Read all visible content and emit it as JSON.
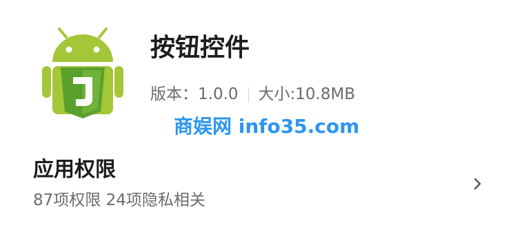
{
  "app": {
    "name": "按钮控件",
    "version_label": "版本：",
    "version_value": "1.0.0",
    "size_label": "大小:",
    "size_value": "10.8MB",
    "icon": "android-html5-icon"
  },
  "watermark": "商娱网 info35.com",
  "permissions": {
    "title": "应用权限",
    "summary": "87项权限 24项隐私相关"
  },
  "colors": {
    "android_green": "#a4c639",
    "shield_green": "#5aa02c",
    "watermark_blue": "#2c96ef",
    "primary_text": "#1c1c1c",
    "secondary_text": "#6b6b6b"
  }
}
